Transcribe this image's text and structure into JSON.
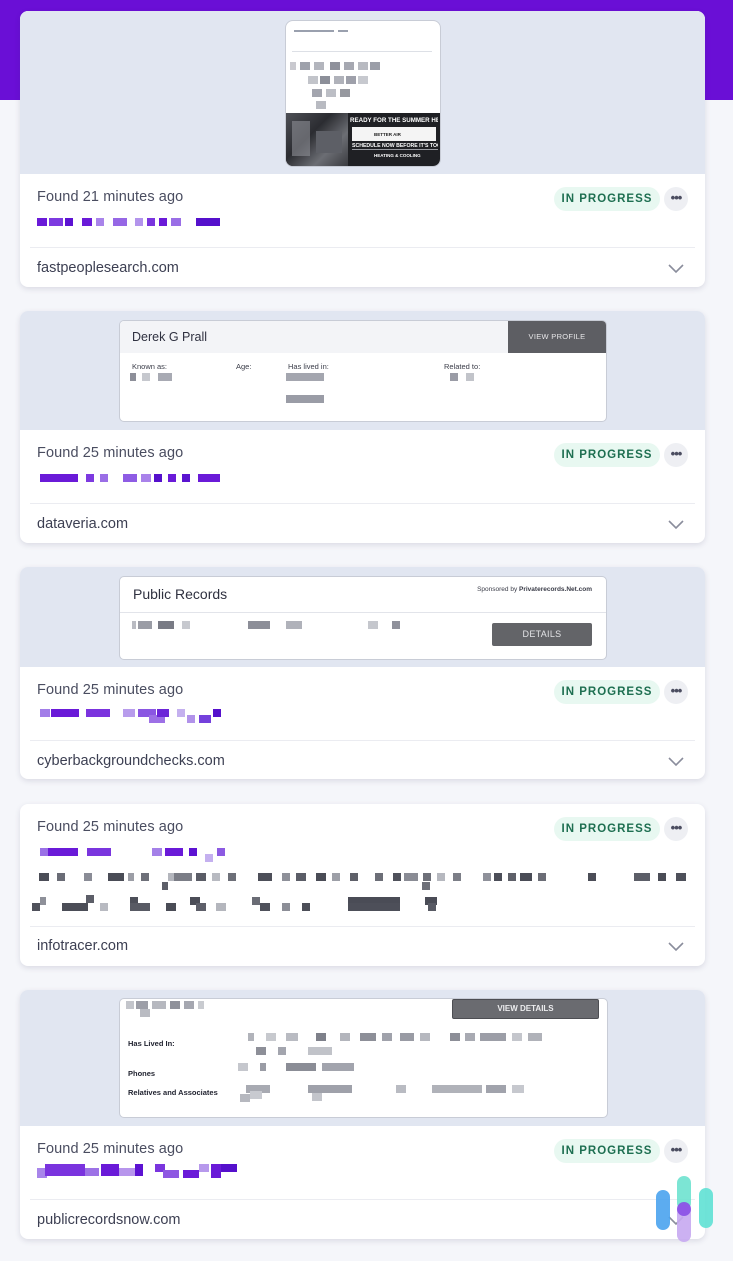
{
  "results": [
    {
      "found": "Found 21 minutes ago",
      "status": "IN PROGRESS",
      "domain": "fastpeoplesearch.com",
      "preview": {
        "ad_lines": [
          "READY FOR THE SUMMER HEAT",
          "BETTER AIR",
          "SCHEDULE NOW BEFORE IT'S TOO LATE",
          "HEATING & COOLING"
        ]
      }
    },
    {
      "found": "Found 25 minutes ago",
      "status": "IN PROGRESS",
      "domain": "dataveria.com",
      "preview": {
        "name": "Derek G Prall",
        "button": "VIEW PROFILE",
        "known_as": "Known as:",
        "age": "Age:",
        "has_lived_in": "Has lived in:",
        "related_to": "Related to:"
      }
    },
    {
      "found": "Found 25 minutes ago",
      "status": "IN PROGRESS",
      "domain": "cyberbackgroundchecks.com",
      "preview": {
        "title": "Public Records",
        "sponsored_prefix": "Sponsored by ",
        "sponsor": "Privaterecords.Net.com",
        "button": "DETAILS"
      }
    },
    {
      "found": "Found 25 minutes ago",
      "status": "IN PROGRESS",
      "domain": "infotracer.com"
    },
    {
      "found": "Found 25 minutes ago",
      "status": "IN PROGRESS",
      "domain": "publicrecordsnow.com",
      "preview": {
        "button": "VIEW DETAILS",
        "has_lived_in": "Has Lived In:",
        "phones": "Phones",
        "relatives": "Relatives and Associates"
      }
    }
  ],
  "more_glyph": "•••",
  "icons": [
    "more-options-icon",
    "chevron-down-icon",
    "watermark-logo-icon"
  ],
  "colors": {
    "header_purple": "#6a0fd6",
    "redaction_purple": "#6a1ad8",
    "badge_bg": "#e8f8f1",
    "badge_text": "#1e6f51",
    "preview_bg": "#e1e6f1"
  }
}
